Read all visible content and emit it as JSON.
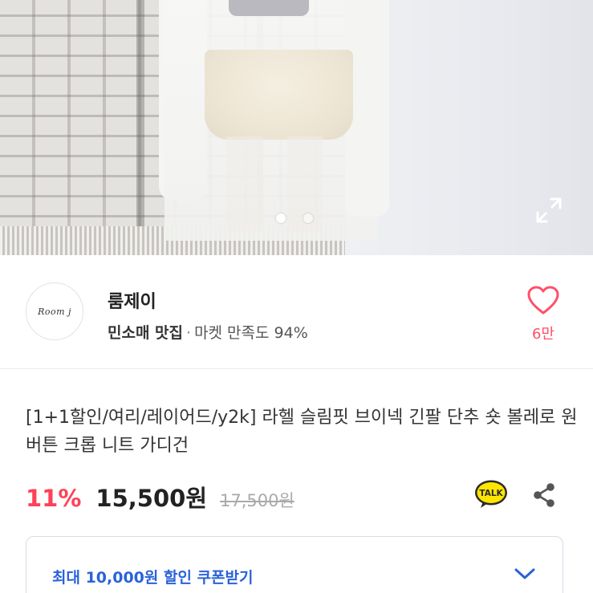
{
  "gallery": {
    "current_index": 1,
    "total": 2
  },
  "seller": {
    "avatar_text": "Room j",
    "name": "룸제이",
    "tag": "민소매 맛집",
    "separator": "·",
    "satisfaction": "마켓 만족도 94%",
    "like_count": "6만"
  },
  "product": {
    "title": "[1+1할인/여리/레이어드/y2k] 라헬 슬림핏 브이넥 긴팔 단추 숏 볼레로 원버튼 크롭 니트 가디건",
    "discount": "11%",
    "price": "15,500원",
    "original_price": "17,500원",
    "talk_label": "TALK"
  },
  "coupon": {
    "label": "최대 10,000원 할인 쿠폰받기"
  },
  "icons": {
    "heart": "heart-icon",
    "expand": "expand-icon",
    "share": "share-icon",
    "talk": "kakao-talk-icon",
    "chevron": "chevron-down-icon"
  },
  "colors": {
    "accent_red": "#ff4158",
    "heart_pink": "#ff4f6a",
    "coupon_blue": "#2a62d9",
    "talk_yellow": "#fee500"
  }
}
